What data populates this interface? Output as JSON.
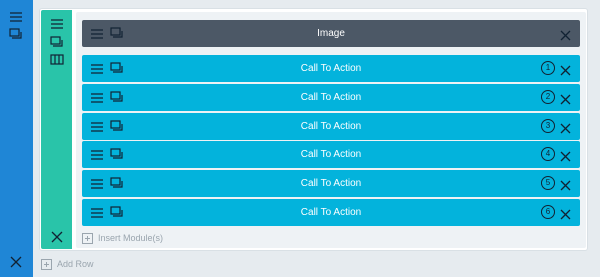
{
  "colors": {
    "section_bar": "#1f86d6",
    "row_bar": "#29c4a9",
    "image_module": "#4c5866",
    "cta_module": "#03b3dc",
    "background": "#e6ebef"
  },
  "section": {
    "icons": [
      "hamburger-icon",
      "duplicate-icon",
      "close-icon"
    ]
  },
  "row": {
    "icons": [
      "hamburger-icon",
      "duplicate-icon",
      "columns-icon",
      "close-icon"
    ]
  },
  "modules": [
    {
      "label": "Image",
      "type": "image",
      "number": ""
    },
    {
      "label": "Call To Action",
      "type": "cta",
      "number": "1"
    },
    {
      "label": "Call To Action",
      "type": "cta",
      "number": "2"
    },
    {
      "label": "Call To Action",
      "type": "cta",
      "number": "3"
    },
    {
      "label": "Call To Action",
      "type": "cta",
      "number": "4"
    },
    {
      "label": "Call To Action",
      "type": "cta",
      "number": "5"
    },
    {
      "label": "Call To Action",
      "type": "cta",
      "number": "6"
    }
  ],
  "insert_module_label": "Insert Module(s)",
  "add_row_label": "Add Row"
}
